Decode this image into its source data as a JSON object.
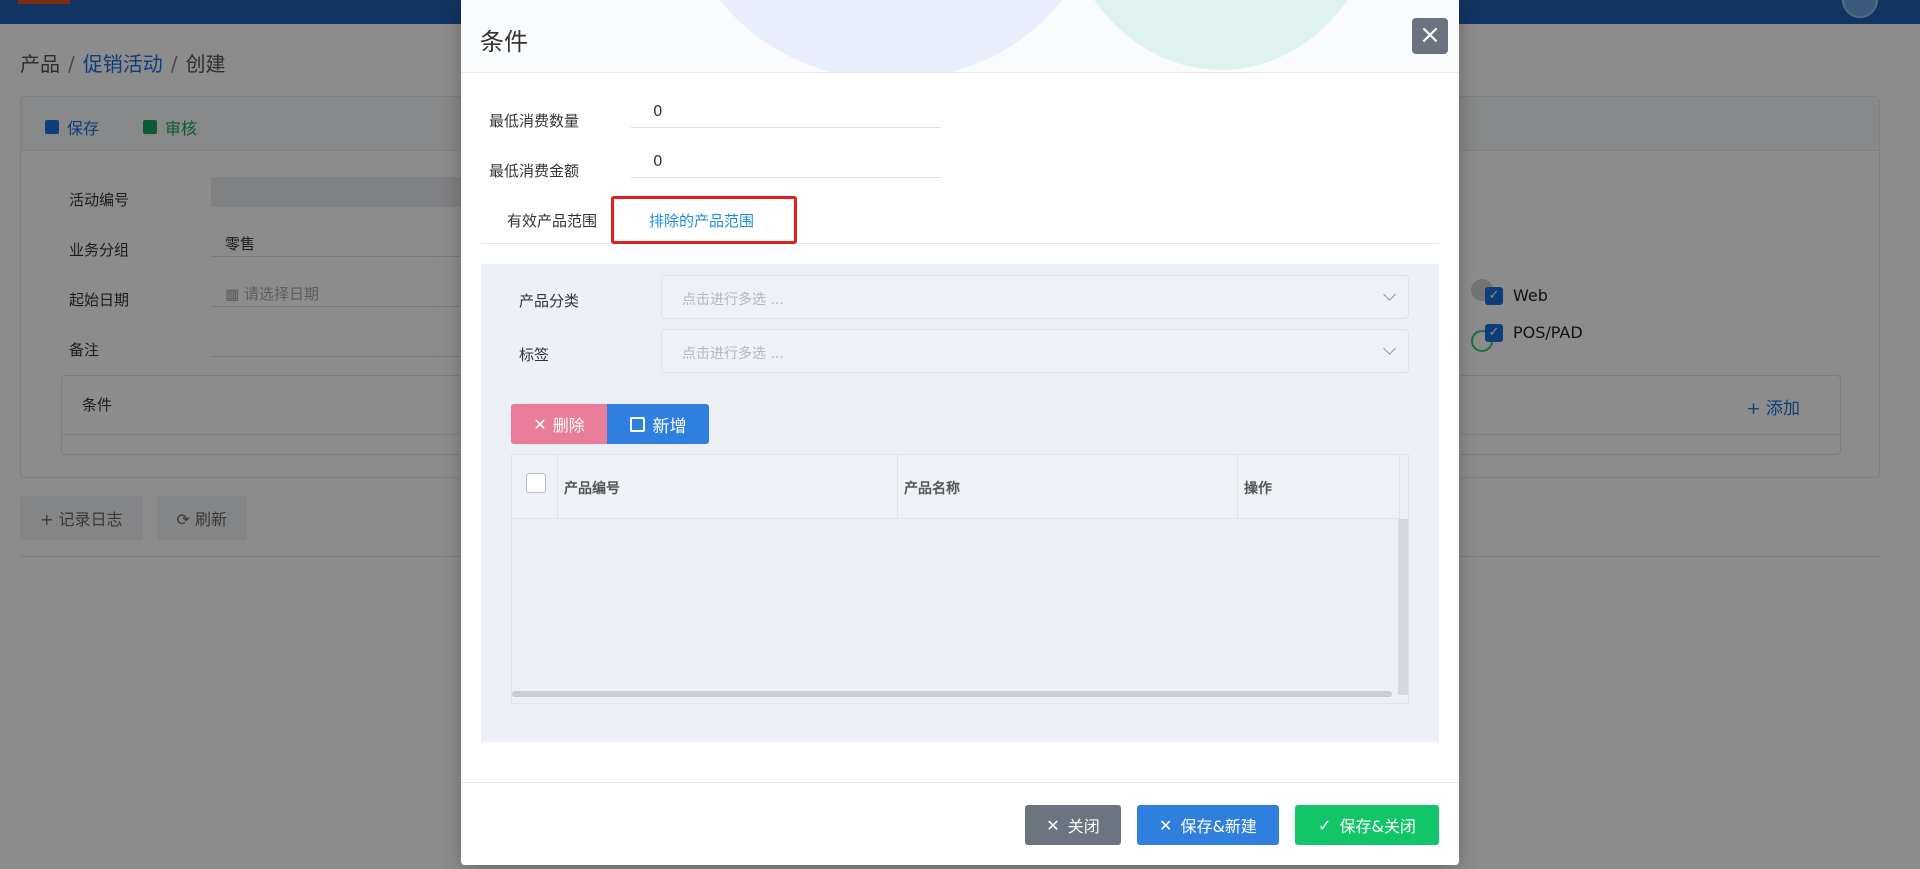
{
  "breadcrumb": {
    "root": "产品",
    "parent": "促销活动",
    "current": "创建",
    "sep": "/"
  },
  "toolbar": {
    "save": "保存",
    "audit": "审核"
  },
  "form": {
    "activity_no_label": "活动编号",
    "business_group_label": "业务分组",
    "business_group_value": "零售",
    "start_date_label": "起始日期",
    "start_date_placeholder": "请选择日期",
    "remark_label": "备注",
    "conditions_label": "条件",
    "add_link": "添加"
  },
  "channels": [
    "Web",
    "POS/PAD"
  ],
  "bottom_actions": {
    "log": "记录日志",
    "refresh": "刷新"
  },
  "modal": {
    "title": "条件",
    "close_icon": "×",
    "min_qty_label": "最低消费数量",
    "min_qty_value": "0",
    "min_amount_label": "最低消费金额",
    "min_amount_value": "0",
    "tabs": [
      "有效产品范围",
      "排除的产品范围"
    ],
    "active_tab": 1,
    "category_label": "产品分类",
    "category_placeholder": "点击进行多选 ...",
    "tag_label": "标签",
    "tag_placeholder": "点击进行多选 ...",
    "delete_btn": "删除",
    "new_btn": "新增",
    "columns": [
      "产品编号",
      "产品名称",
      "操作"
    ],
    "rows": [],
    "footer": {
      "close": "关闭",
      "save_new": "保存&新建",
      "save_close": "保存&关闭"
    }
  },
  "colors": {
    "primary": "#2f7fdf",
    "danger": "#ea7d99",
    "success": "#12c569",
    "highlight": "#e02020"
  }
}
